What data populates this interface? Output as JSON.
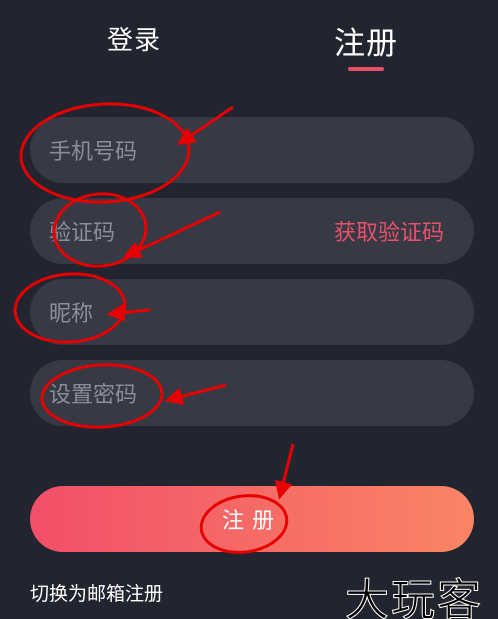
{
  "tabs": {
    "login_label": "登录",
    "register_label": "注册",
    "active": "register"
  },
  "form": {
    "phone_placeholder": "手机号码",
    "code_placeholder": "验证码",
    "get_code_label": "获取验证码",
    "nickname_placeholder": "昵称",
    "password_placeholder": "设置密码"
  },
  "submit_label": "注册",
  "switch_label": "切换为邮箱注册",
  "watermark_text": "大玩客",
  "colors": {
    "background": "#22242f",
    "field": "#373945",
    "accent": "#e84d68",
    "gradient_start": "#f24f68",
    "gradient_end": "#f98565",
    "annotation": "#e60000"
  }
}
